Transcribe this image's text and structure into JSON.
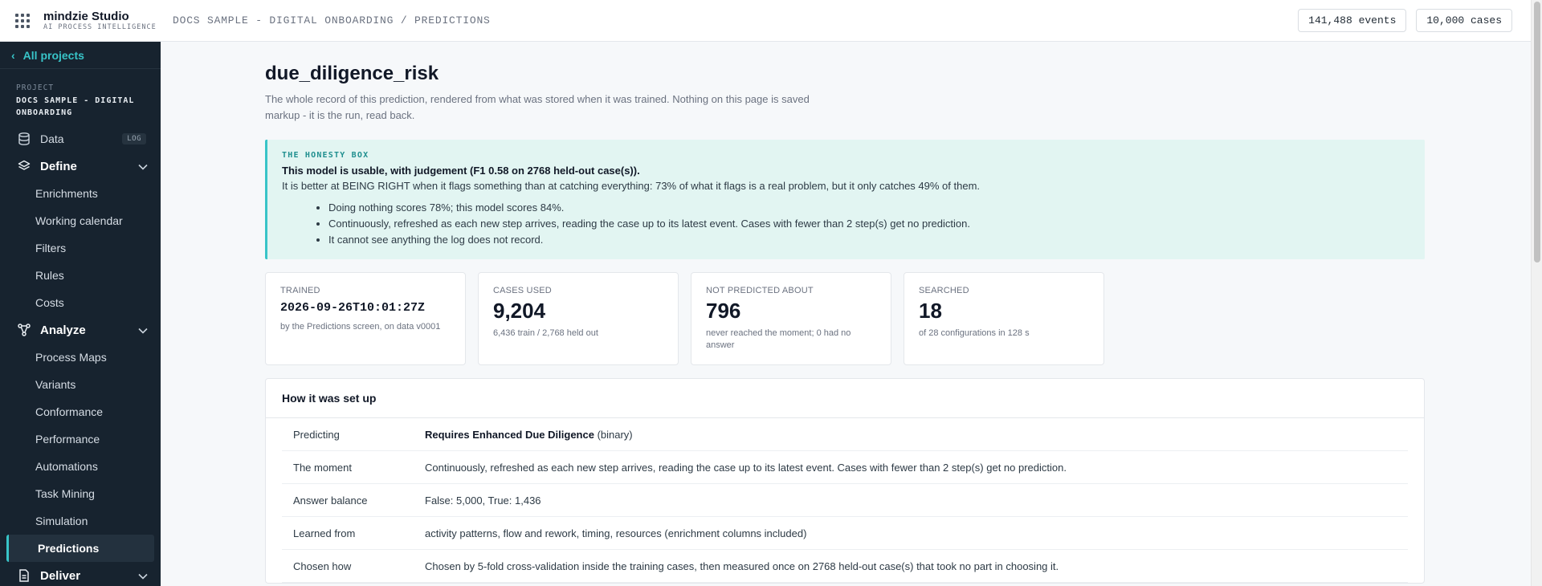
{
  "app": {
    "brand_name": "mindzie Studio",
    "brand_sub": "AI PROCESS INTELLIGENCE",
    "breadcrumb": "DOCS SAMPLE - DIGITAL ONBOARDING / PREDICTIONS",
    "events_pill": "141,488 events",
    "cases_pill": "10,000 cases"
  },
  "sidebar": {
    "all_projects": "All projects",
    "project_label": "PROJECT",
    "project_name": "DOCS SAMPLE - DIGITAL ONBOARDING",
    "data_label": "Data",
    "data_tag": "LOG",
    "define_label": "Define",
    "define_items": [
      "Enrichments",
      "Working calendar",
      "Filters",
      "Rules",
      "Costs"
    ],
    "analyze_label": "Analyze",
    "analyze_items": [
      "Process Maps",
      "Variants",
      "Conformance",
      "Performance",
      "Automations",
      "Task Mining",
      "Simulation"
    ],
    "active_item": "Predictions",
    "deliver_label": "Deliver"
  },
  "page": {
    "title": "due_diligence_risk",
    "subtitle": "The whole record of this prediction, rendered from what was stored when it was trained. Nothing on this page is saved markup - it is the run, read back."
  },
  "honesty": {
    "kicker": "THE HONESTY BOX",
    "verdict": "This model is usable, with judgement (F1 0.58 on 2768 held-out case(s)).",
    "explain": "It is better at BEING RIGHT when it flags something than at catching everything: 73% of what it flags is a real problem, but it only catches 49% of them.",
    "bullets": [
      "Doing nothing scores 78%; this model scores 84%.",
      "Continuously, refreshed as each new step arrives, reading the case up to its latest event. Cases with fewer than 2 step(s) get no prediction.",
      "It cannot see anything the log does not record."
    ]
  },
  "cards": {
    "trained": {
      "label": "TRAINED",
      "value": "2026-09-26T10:01:27Z",
      "note": "by the Predictions screen, on data v0001"
    },
    "cases_used": {
      "label": "CASES USED",
      "value": "9,204",
      "note": "6,436 train / 2,768 held out"
    },
    "not_predicted": {
      "label": "NOT PREDICTED ABOUT",
      "value": "796",
      "note": "never reached the moment; 0 had no answer"
    },
    "searched": {
      "label": "SEARCHED",
      "value": "18",
      "note": "of 28 configurations in 128 s"
    }
  },
  "setup": {
    "heading": "How it was set up",
    "rows": [
      {
        "key": "Predicting",
        "value_bold": "Requires Enhanced Due Diligence",
        "value": " (binary)"
      },
      {
        "key": "The moment",
        "value_bold": "",
        "value": "Continuously, refreshed as each new step arrives, reading the case up to its latest event. Cases with fewer than 2 step(s) get no prediction."
      },
      {
        "key": "Answer balance",
        "value_bold": "",
        "value": "False: 5,000, True: 1,436"
      },
      {
        "key": "Learned from",
        "value_bold": "",
        "value": "activity patterns, flow and rework, timing, resources (enrichment columns included)"
      },
      {
        "key": "Chosen how",
        "value_bold": "",
        "value": "Chosen by 5-fold cross-validation inside the training cases, then measured once on 2768 held-out case(s) that took no part in choosing it."
      }
    ]
  },
  "colors": {
    "accent": "#38c4c8",
    "sidebar_bg": "#17232f",
    "honesty_bg": "#e2f5f2"
  }
}
